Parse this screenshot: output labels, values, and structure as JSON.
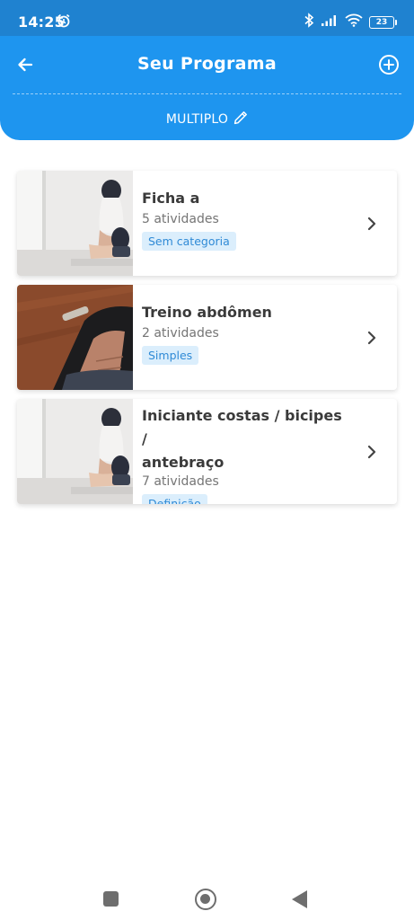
{
  "status_bar": {
    "time": "14:25",
    "battery": "23",
    "icons": [
      "alarm-icon",
      "bluetooth-icon",
      "signal-icon",
      "wifi-icon",
      "battery-icon"
    ]
  },
  "header": {
    "title": "Seu Programa",
    "program_type": "MULTIPLO",
    "back_icon": "arrow-left-icon",
    "add_icon": "plus-circle-icon",
    "edit_icon": "pencil-icon",
    "color": "#1e95ef"
  },
  "workouts": [
    {
      "title": "Ficha a",
      "count": "5 atividades",
      "tag": "Sem categoria",
      "image": "stretching-photo"
    },
    {
      "title": "Treino abdômen",
      "count": "2 atividades",
      "tag": "Simples",
      "image": "abs-photo"
    },
    {
      "title_line1": "Iniciante costas / bicipes /",
      "title_line2": "antebraço",
      "count": "7 atividades",
      "tag": "Definição",
      "image": "stretching-photo"
    }
  ],
  "nav_bar": {
    "icons": [
      "recent-apps-icon",
      "home-icon",
      "back-triangle-icon"
    ]
  }
}
